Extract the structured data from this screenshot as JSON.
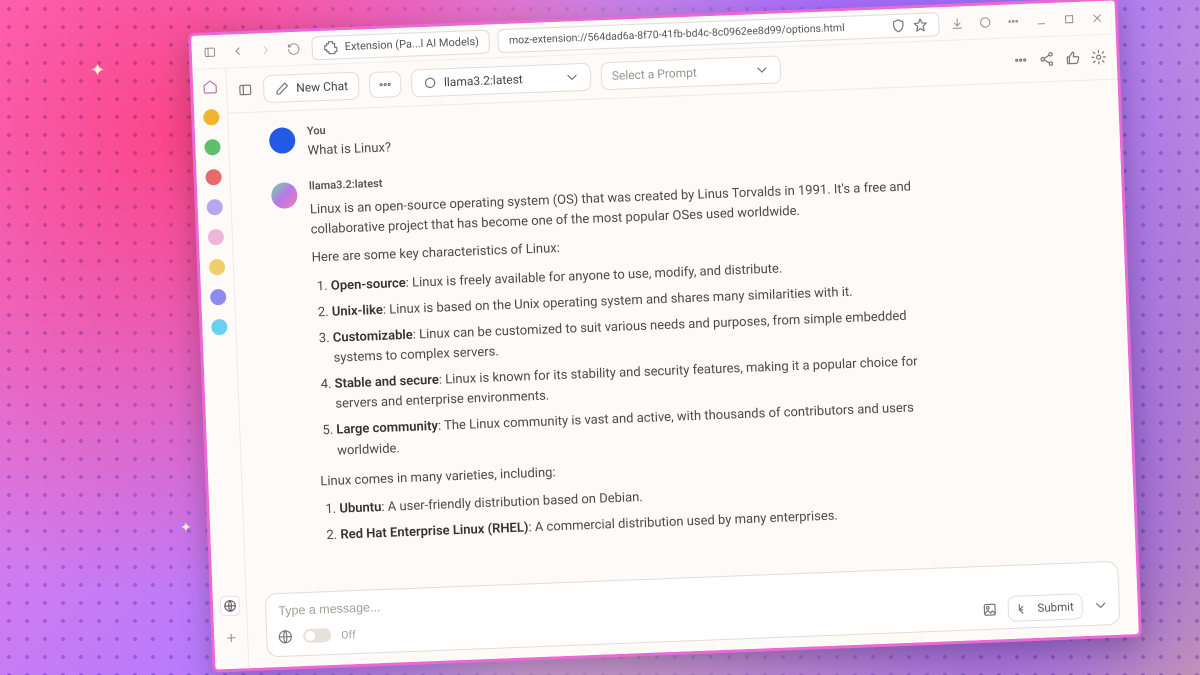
{
  "titlebar": {
    "tab_label": "Extension (Pa...l AI Models)",
    "url": "moz-extension://564dad6a-8f70-41fb-bd4c-8c0962ee8d99/options.html"
  },
  "toolbar": {
    "new_chat_label": "New Chat",
    "model_selected": "llama3.2:latest",
    "prompt_placeholder": "Select a Prompt"
  },
  "chat": {
    "user_name": "You",
    "user_text": "What is Linux?",
    "bot_name": "llama3.2:latest",
    "bot_intro": "Linux is an open-source operating system (OS) that was created by Linus Torvalds in 1991. It's a free and collaborative project that has become one of the most popular OSes used worldwide.",
    "bot_char_lead": "Here are some key characteristics of Linux:",
    "characteristics": [
      {
        "term": "Open-source",
        "desc": ": Linux is freely available for anyone to use, modify, and distribute."
      },
      {
        "term": "Unix-like",
        "desc": ": Linux is based on the Unix operating system and shares many similarities with it."
      },
      {
        "term": "Customizable",
        "desc": ": Linux can be customized to suit various needs and purposes, from simple embedded systems to complex servers."
      },
      {
        "term": "Stable and secure",
        "desc": ": Linux is known for its stability and security features, making it a popular choice for servers and enterprise environments."
      },
      {
        "term": "Large community",
        "desc": ": The Linux community is vast and active, with thousands of contributors and users worldwide."
      }
    ],
    "bot_var_lead": "Linux comes in many varieties, including:",
    "varieties": [
      {
        "term": "Ubuntu",
        "desc": ": A user-friendly distribution based on Debian."
      },
      {
        "term": "Red Hat Enterprise Linux (RHEL)",
        "desc": ": A commercial distribution used by many enterprises."
      }
    ]
  },
  "composer": {
    "placeholder": "Type a message...",
    "toggle_label": "Off",
    "submit_label": "Submit"
  }
}
